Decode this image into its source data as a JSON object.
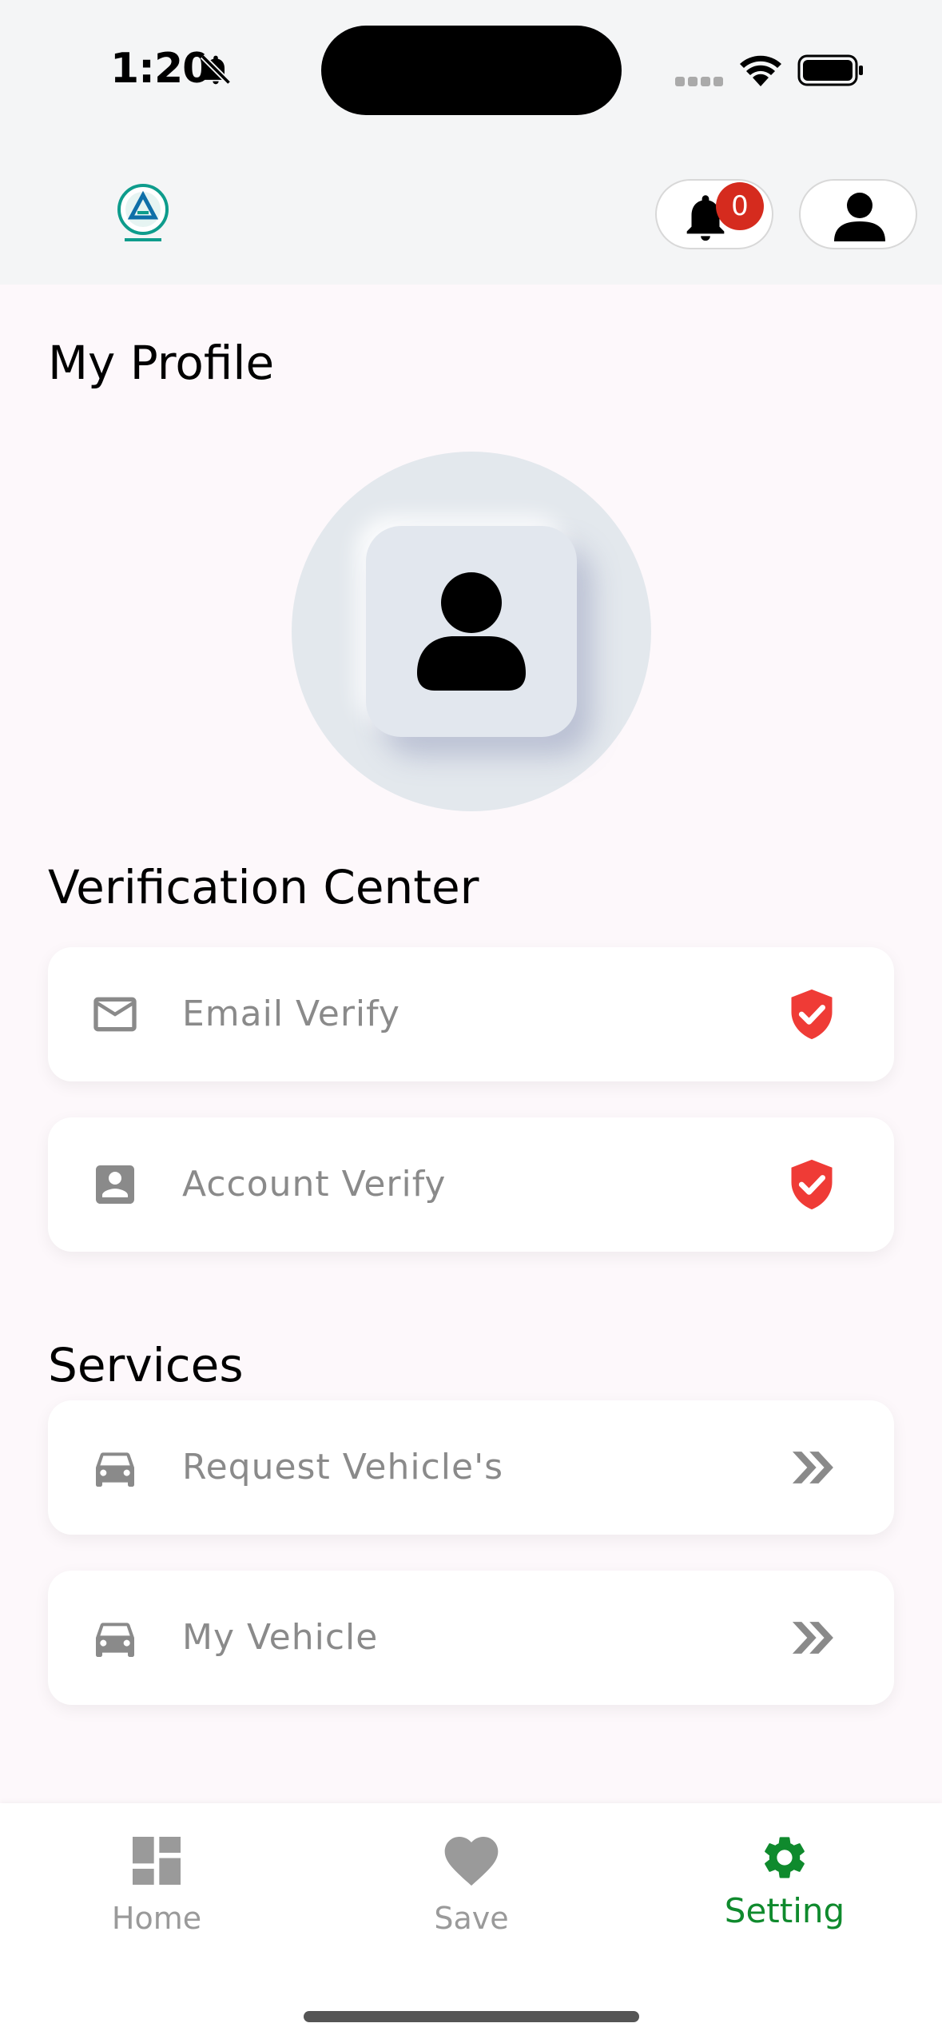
{
  "status_bar": {
    "time": "1:20"
  },
  "header": {
    "notification_count": "0",
    "logo_icon": "all-one-auto-logo"
  },
  "profile": {
    "title": "My Profile"
  },
  "verification": {
    "title": "Verification Center",
    "items": [
      {
        "label": "Email Verify",
        "icon": "mail-icon",
        "status_icon": "shield-check-icon",
        "status_color": "#ef3b36"
      },
      {
        "label": "Account Verify",
        "icon": "account-box-icon",
        "status_icon": "shield-check-icon",
        "status_color": "#ef3b36"
      }
    ]
  },
  "services": {
    "title": "Services",
    "items": [
      {
        "label": "Request Vehicle's",
        "icon": "car-icon",
        "trail_icon": "double-chevron-right-icon"
      },
      {
        "label": "My Vehicle",
        "icon": "car-icon",
        "trail_icon": "double-chevron-right-icon"
      }
    ]
  },
  "bottom_nav": {
    "items": [
      {
        "label": "Home",
        "icon": "dashboard-icon",
        "active": false
      },
      {
        "label": "Save",
        "icon": "heart-icon",
        "active": false
      },
      {
        "label": "Setting",
        "icon": "gear-icon",
        "active": true
      }
    ],
    "active_color": "#0f8a2d"
  }
}
